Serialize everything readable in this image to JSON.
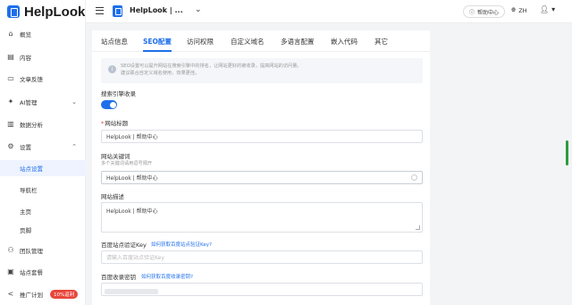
{
  "app": {
    "logo_text": "HelpLook"
  },
  "sidebar": {
    "items": [
      {
        "label": "概览",
        "icon": "home-icon"
      },
      {
        "label": "内容",
        "icon": "document-icon"
      },
      {
        "label": "文章反馈",
        "icon": "feedback-icon"
      },
      {
        "label": "AI管理",
        "icon": "ai-icon"
      },
      {
        "label": "数据分析",
        "icon": "chart-icon"
      },
      {
        "label": "设置",
        "icon": "gear-icon"
      }
    ],
    "settings_sub": [
      {
        "label": "站点设置",
        "active": true
      },
      {
        "label": "导航栏"
      },
      {
        "label": "主页"
      },
      {
        "label": "页脚"
      }
    ],
    "bottom_items": [
      {
        "label": "团队管理",
        "icon": "team-icon"
      },
      {
        "label": "站点套餐",
        "icon": "package-icon"
      },
      {
        "label": "推广计划",
        "icon": "share-icon",
        "badge": "10%返利"
      }
    ]
  },
  "topbar": {
    "kb_title": "HelpLook | ...",
    "help_label": "帮助中心",
    "lang_label": "ZH"
  },
  "tabs": [
    {
      "label": "站点信息"
    },
    {
      "label": "SEO配置",
      "active": true
    },
    {
      "label": "访问权限"
    },
    {
      "label": "自定义域名"
    },
    {
      "label": "多语言配置"
    },
    {
      "label": "嵌入代码"
    },
    {
      "label": "其它"
    }
  ],
  "seo": {
    "info_line1": "SEO设置可以提升网站在搜索引擎中的排名，让网站更好的被收录，提高网站的访问量。",
    "info_line2": "建议联合自定义域名使用，效果更佳。",
    "index_label": "搜索引擎收录",
    "index_enabled": true,
    "site_title_label": "网站标题",
    "site_title_value": "HelpLook | 帮助中心",
    "keywords_label": "网站关键词",
    "keywords_hint": "多个关键词请用逗号隔开",
    "keywords_value": "HelpLook | 帮助中心",
    "description_label": "网站描述",
    "description_value": "HelpLook | 帮助中心",
    "baidu_label": "百度站点验证Key",
    "baidu_link": "如何获取百度站点验证Key?",
    "baidu_placeholder": "请输入百度站点验证Key",
    "baidu_secret_label": "百度收录密钥",
    "baidu_secret_link": "如何获取百度收录密钥?"
  },
  "colors": {
    "accent": "#1f6feb",
    "badge": "#e8463b",
    "scrollbar": "#2e9c3f"
  }
}
